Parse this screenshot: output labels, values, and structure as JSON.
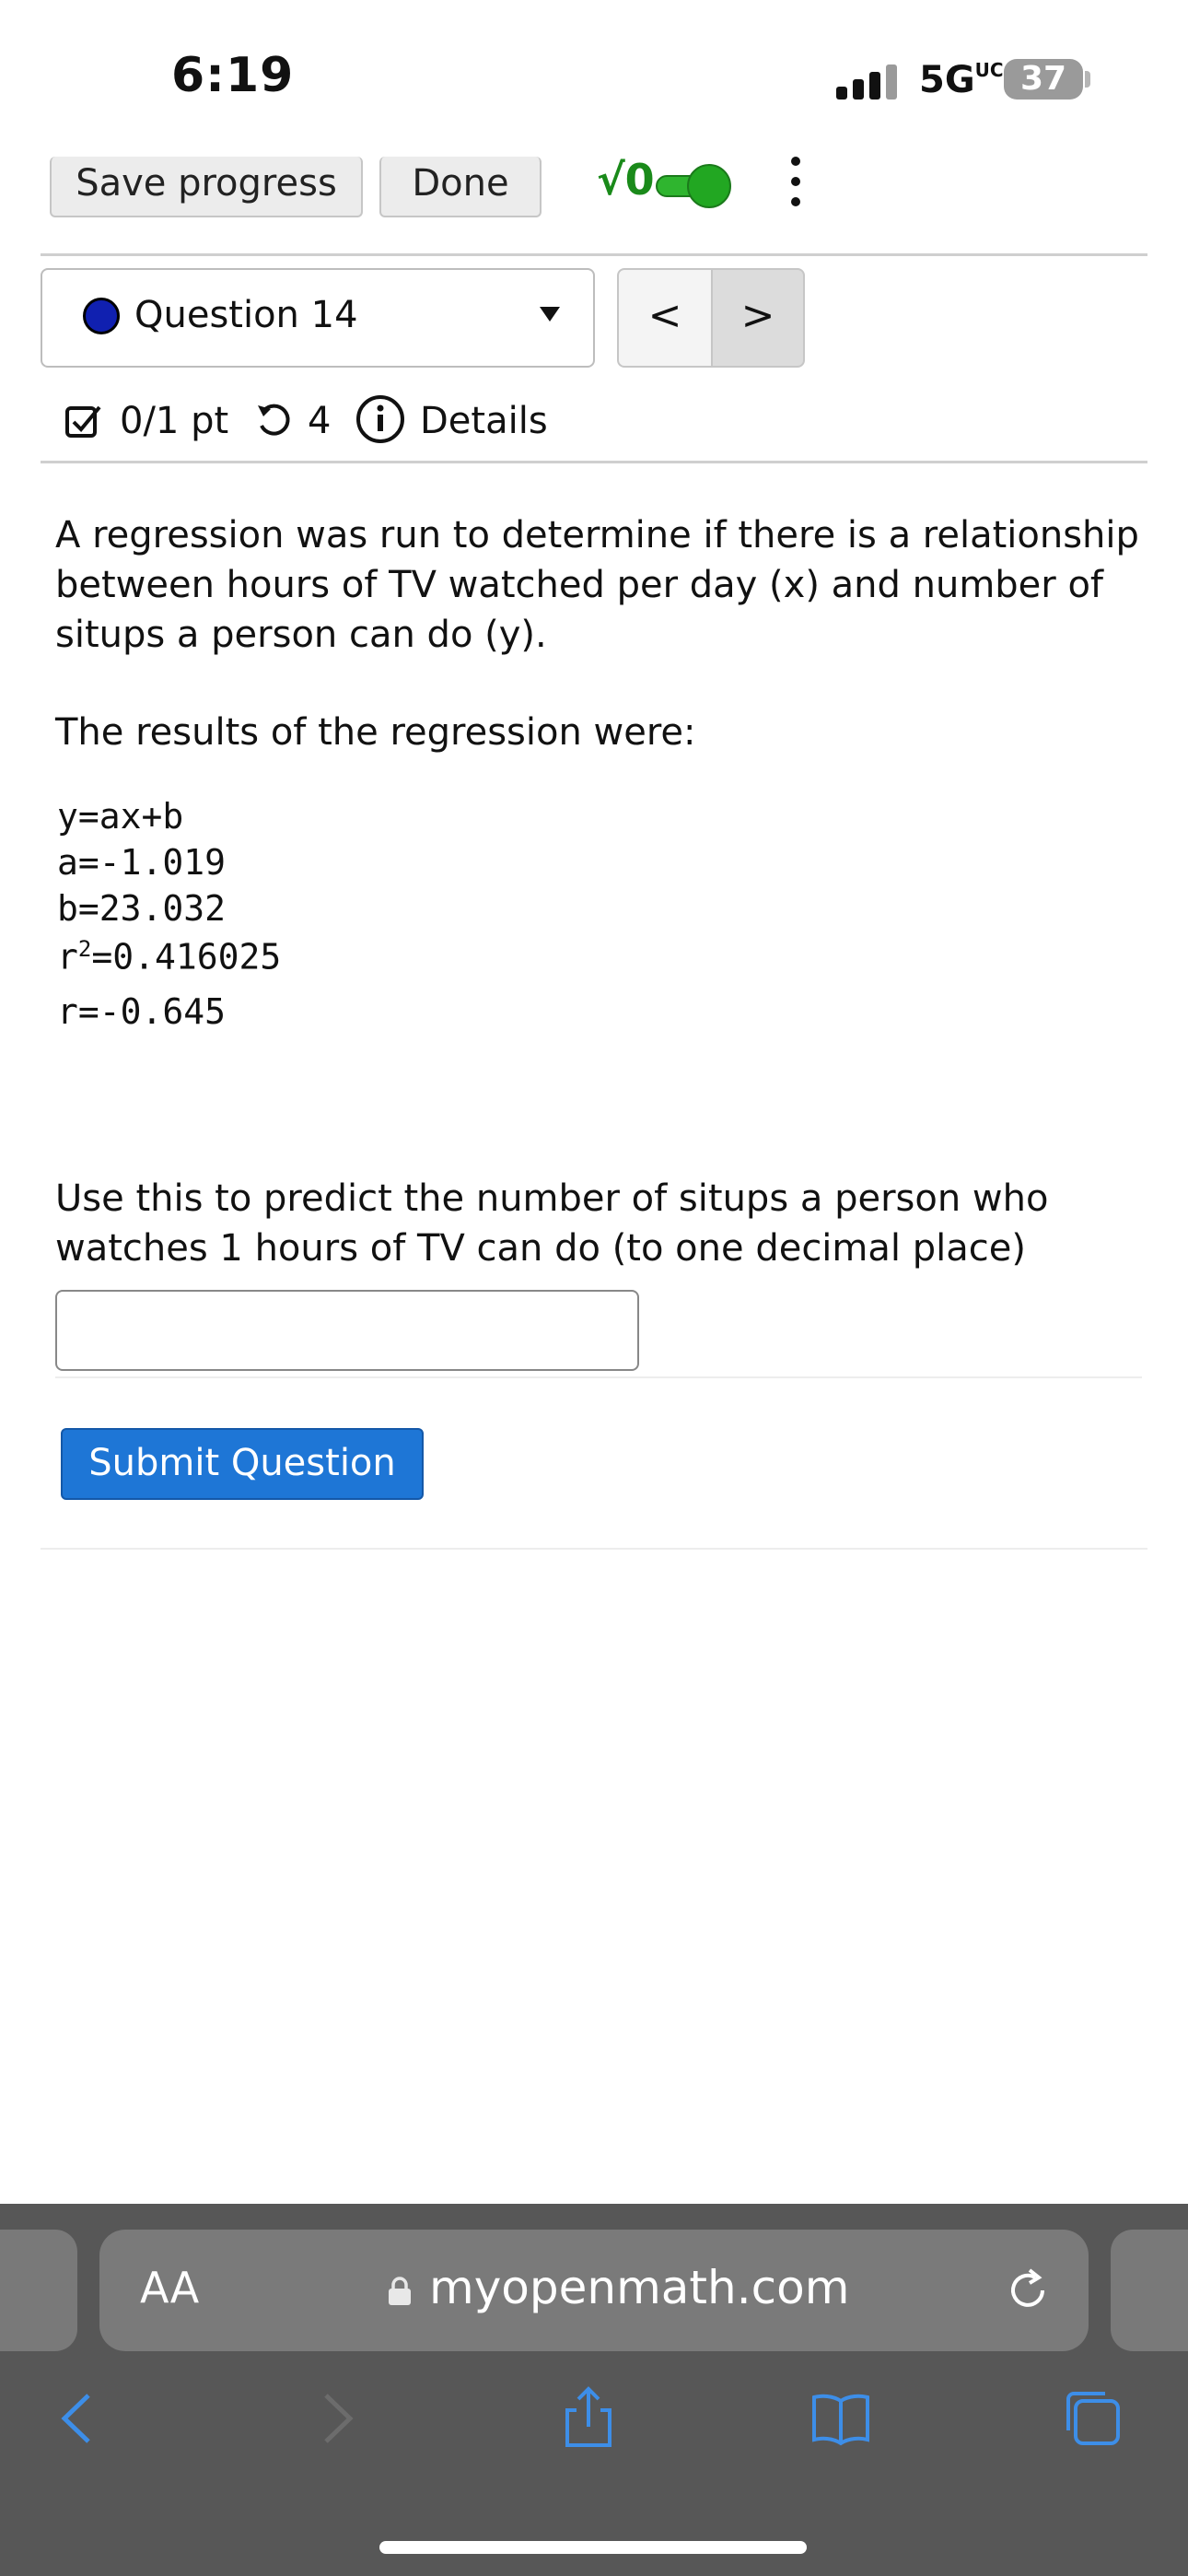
{
  "status_bar": {
    "time": "6:19",
    "network": "5G",
    "network_suffix": "UC",
    "battery": "37"
  },
  "toolbar": {
    "save_label": "Save progress",
    "done_label": "Done",
    "sqrt_symbol": "√0"
  },
  "question_nav": {
    "label": "Question 14",
    "prev": "<",
    "next": ">"
  },
  "score": {
    "points": "0/1 pt",
    "attempts": "4",
    "details_label": "Details"
  },
  "question": {
    "intro": "A regression was run to determine if there is a relationship between hours of TV watched per day (x) and number of situps a person can do (y).",
    "results_label": "The results of the regression were:",
    "equation": "y=ax+b",
    "a": "a=-1.019",
    "b": "b=23.032",
    "r2_prefix": "r",
    "r2_exp": "2",
    "r2_value": "=0.416025",
    "r": "r=-0.645",
    "prompt": "Use this to predict the number of situps a person who watches 1 hours of TV can do (to one decimal place)",
    "answer_value": "",
    "submit_label": "Submit Question"
  },
  "browser": {
    "text_size_label": "AA",
    "url": "myopenmath.com"
  },
  "colors": {
    "submit": "#1e76d6",
    "toggle": "#2fb52f",
    "sqrt": "#1a8a1a",
    "question_dot": "#1020b0",
    "safari_bg": "#575757",
    "safari_icons": "#3d8ee8"
  }
}
